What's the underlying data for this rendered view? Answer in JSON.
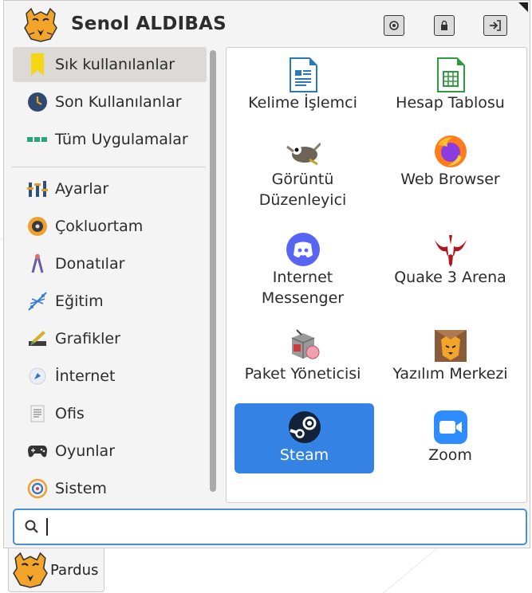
{
  "user": {
    "name": "Senol ALDIBAS"
  },
  "header_buttons": [
    {
      "icon": "screen-lock-icon",
      "label": ""
    },
    {
      "icon": "lock-icon",
      "label": ""
    },
    {
      "icon": "logout-icon",
      "label": ""
    }
  ],
  "categories": [
    {
      "label": "Sık kullanılanlar",
      "icon": "bookmark-icon",
      "selected": true
    },
    {
      "label": "Son Kullanılanlar",
      "icon": "clock-icon"
    },
    {
      "label": "Tüm Uygulamalar",
      "icon": "dots-icon"
    },
    {
      "label": "Ayarlar",
      "icon": "settings-sliders-icon"
    },
    {
      "label": "Çokluortam",
      "icon": "multimedia-icon"
    },
    {
      "label": "Donatılar",
      "icon": "accessories-icon"
    },
    {
      "label": "Eğitim",
      "icon": "education-icon"
    },
    {
      "label": "Grafikler",
      "icon": "graphics-icon"
    },
    {
      "label": "İnternet",
      "icon": "internet-icon"
    },
    {
      "label": "Ofis",
      "icon": "office-icon"
    },
    {
      "label": "Oyunlar",
      "icon": "gamepad-icon"
    },
    {
      "label": "Sistem",
      "icon": "system-icon"
    }
  ],
  "apps": [
    {
      "label": "Kelime İşlemci",
      "icon": "writer-icon"
    },
    {
      "label": "Hesap Tablosu",
      "icon": "calc-icon"
    },
    {
      "label": "Görüntü\nDüzenleyici",
      "icon": "gimp-icon"
    },
    {
      "label": "Web Browser",
      "icon": "firefox-icon"
    },
    {
      "label": "Internet\nMessenger",
      "icon": "discord-icon"
    },
    {
      "label": "Quake 3 Arena",
      "icon": "quake-icon"
    },
    {
      "label": "Paket Yöneticisi",
      "icon": "package-manager-icon"
    },
    {
      "label": "Yazılım Merkezi",
      "icon": "software-center-icon"
    },
    {
      "label": "Steam",
      "icon": "steam-icon",
      "active": true
    },
    {
      "label": "Zoom",
      "icon": "zoom-icon"
    }
  ],
  "search": {
    "value": "",
    "placeholder": ""
  },
  "taskbar": {
    "label": "Pardus"
  },
  "colors": {
    "accent": "#3582e5",
    "selected_bg": "#dcd9d6",
    "search_border": "#4a90d9"
  }
}
